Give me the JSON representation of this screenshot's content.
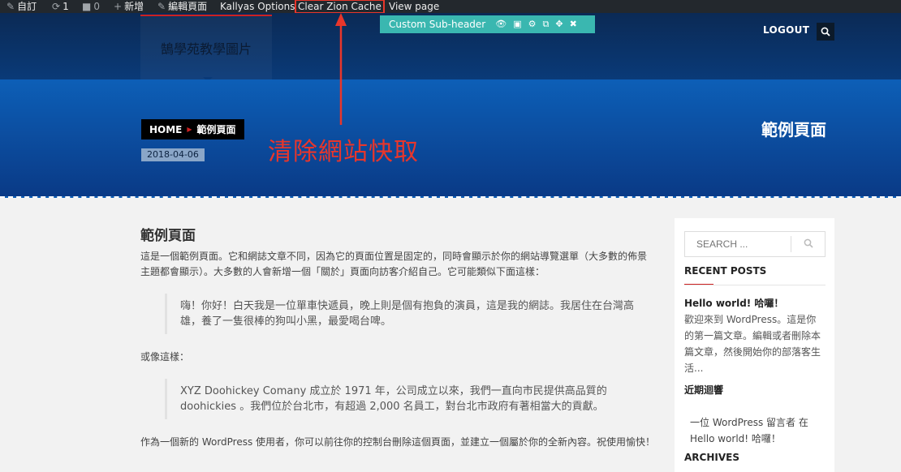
{
  "adminbar": {
    "customize": "自訂",
    "updates_count": "1",
    "comments_count": "0",
    "new_label": "新增",
    "edit_page": "編輯頁面",
    "kallyas": "Kallyas Options",
    "clear_cache": "Clear Zion Cache",
    "view_page": "View page"
  },
  "header": {
    "logo_text": "鵠學苑教學圖片",
    "logout": "LOGOUT"
  },
  "subheader_toolbar": {
    "label": "Custom Sub-header",
    "icons": [
      "eye-icon",
      "save-icon",
      "cogs-icon",
      "copy-icon",
      "move-icon",
      "close-icon"
    ]
  },
  "subheader": {
    "breadcrumb_home": "HOME",
    "breadcrumb_current": "範例頁面",
    "date": "2018-04-06",
    "title": "範例頁面"
  },
  "annotation": {
    "text": "清除網站快取",
    "color": "#e8362b"
  },
  "content": {
    "title": "範例頁面",
    "intro": "這是一個範例頁面。它和網誌文章不同，因為它的頁面位置是固定的，同時會顯示於你的網站導覽選單（大多數的佈景主題都會顯示）。大多數的人會新增一個「關於」頁面向訪客介紹自己。它可能類似下面這樣：",
    "quote1": "嗨！你好！白天我是一位單車快遞員，晚上則是個有抱負的演員，這是我的網誌。我居住在台灣高雄，養了一隻很棒的狗叫小黑，最愛喝台啤。",
    "or_like": "或像這樣：",
    "quote2": "XYZ Doohickey Comany 成立於 1971 年，公司成立以來，我們一直向市民提供高品質的 doohickies 。我們位於台北市，有超過 2,000 名員工，對台北市政府有著相當大的貢獻。",
    "closing": "作為一個新的 WordPress 使用者，你可以前往你的控制台刪除這個頁面，並建立一個屬於你的全新內容。祝使用愉快！"
  },
  "sidebar": {
    "search_placeholder": "SEARCH ...",
    "recent_posts_title": "RECENT POSTS",
    "post_title": "Hello world! 哈囉！",
    "post_excerpt": "歡迎來到 WordPress。這是你的第一篇文章。編輯或者刪除本篇文章，然後開始你的部落客生活...",
    "recent_comments_title": "近期迴響",
    "comment_author": "一位 WordPress 留言者",
    "comment_on": "在",
    "comment_post": "Hello world! 哈囉！",
    "archives_title": "ARCHIVES"
  }
}
